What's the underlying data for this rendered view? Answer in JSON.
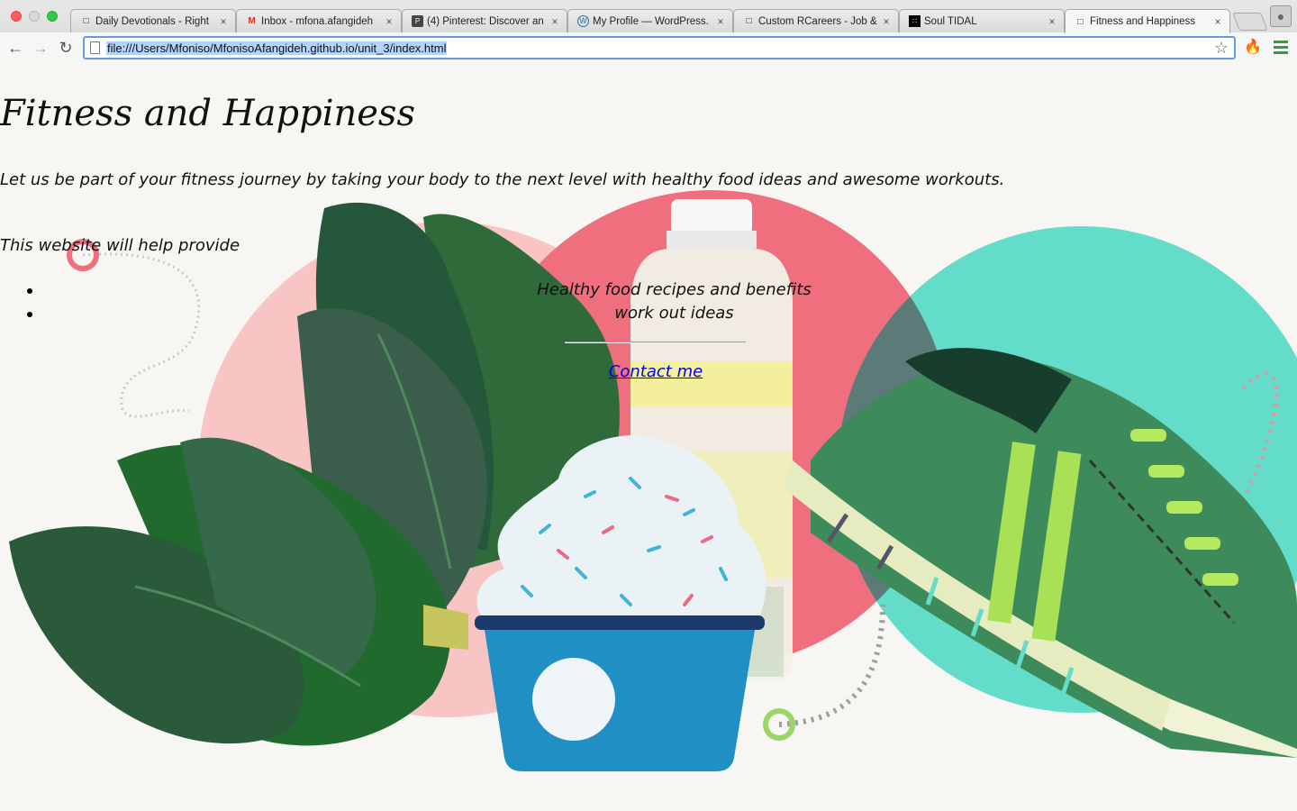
{
  "browser": {
    "tabs": [
      {
        "title": "Daily Devotionals - Right",
        "icon": "page-icon"
      },
      {
        "title": "Inbox - mfona.afangideh",
        "icon": "gmail-icon"
      },
      {
        "title": "(4) Pinterest: Discover an",
        "icon": "pinterest-icon"
      },
      {
        "title": "My Profile — WordPress.",
        "icon": "wordpress-icon"
      },
      {
        "title": "Custom RCareers - Job &",
        "icon": "page-icon"
      },
      {
        "title": "Soul TIDAL",
        "icon": "tidal-icon"
      },
      {
        "title": "Fitness and Happiness",
        "icon": "page-icon",
        "active": true
      }
    ],
    "url": "file:///Users/Mfoniso/MfonisoAfangideh.github.io/unit_3/index.html"
  },
  "page": {
    "title": "Fitness and Happiness",
    "tagline": "Let us be part of your fitness journey by taking your body to the next level with healthy food ideas and awesome workouts.",
    "intro": "This website will help provide",
    "list": [
      "Healthy food recipes and benefits",
      "work out ideas"
    ],
    "contact_label": "Contact me"
  },
  "colors": {
    "pink_circle": "#f8c4c4",
    "red_circle": "#ef6f7e",
    "teal_circle": "#63ddc9",
    "kale": "#2e6b3c",
    "cup": "#1f8fc4"
  }
}
